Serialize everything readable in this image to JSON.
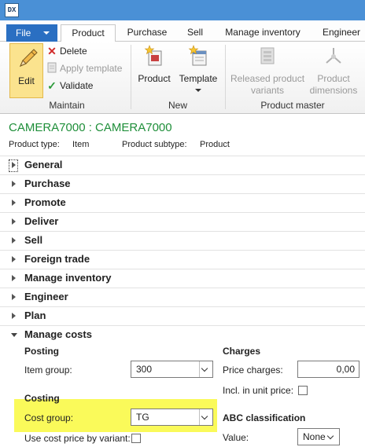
{
  "window": {
    "app_icon_text": "DX"
  },
  "ribbon_tabs": {
    "file": "File",
    "items": [
      "Product",
      "Purchase",
      "Sell",
      "Manage inventory",
      "Engineer"
    ],
    "active": "Product"
  },
  "ribbon": {
    "maintain": {
      "edit": "Edit",
      "delete": "Delete",
      "apply_template": "Apply template",
      "validate": "Validate",
      "label": "Maintain"
    },
    "new": {
      "product": "Product",
      "template": "Template",
      "label": "New"
    },
    "product_master": {
      "released_variants_line1": "Released product",
      "released_variants_line2": "variants",
      "product_dimensions_line1": "Product",
      "product_dimensions_line2": "dimensions",
      "label": "Product master"
    }
  },
  "record": {
    "title": "CAMERA7000 : CAMERA7000",
    "product_type_label": "Product type:",
    "product_type_value": "Item",
    "product_subtype_label": "Product subtype:",
    "product_subtype_value": "Product"
  },
  "fasttabs": [
    "General",
    "Purchase",
    "Promote",
    "Deliver",
    "Sell",
    "Foreign trade",
    "Manage inventory",
    "Engineer",
    "Plan",
    "Manage costs"
  ],
  "manage_costs": {
    "posting_heading": "Posting",
    "item_group_label": "Item group:",
    "item_group_value": "300",
    "costing_heading": "Costing",
    "cost_group_label": "Cost group:",
    "cost_group_value": "TG",
    "use_cost_price_label": "Use cost price by variant:",
    "use_cost_price_checked": false,
    "charges_heading": "Charges",
    "price_charges_label": "Price charges:",
    "price_charges_value": "0,00",
    "incl_unit_price_label": "Incl. in unit price:",
    "incl_unit_price_checked": false,
    "abc_heading": "ABC classification",
    "value_label": "Value:",
    "value_value": "None"
  },
  "colors": {
    "title_bar": "#4a90d6",
    "file_button": "#2a6fc2",
    "record_title": "#1f8f3a",
    "edit_highlight": "#fbe38e",
    "annotation_highlight": "#fafa5a"
  }
}
